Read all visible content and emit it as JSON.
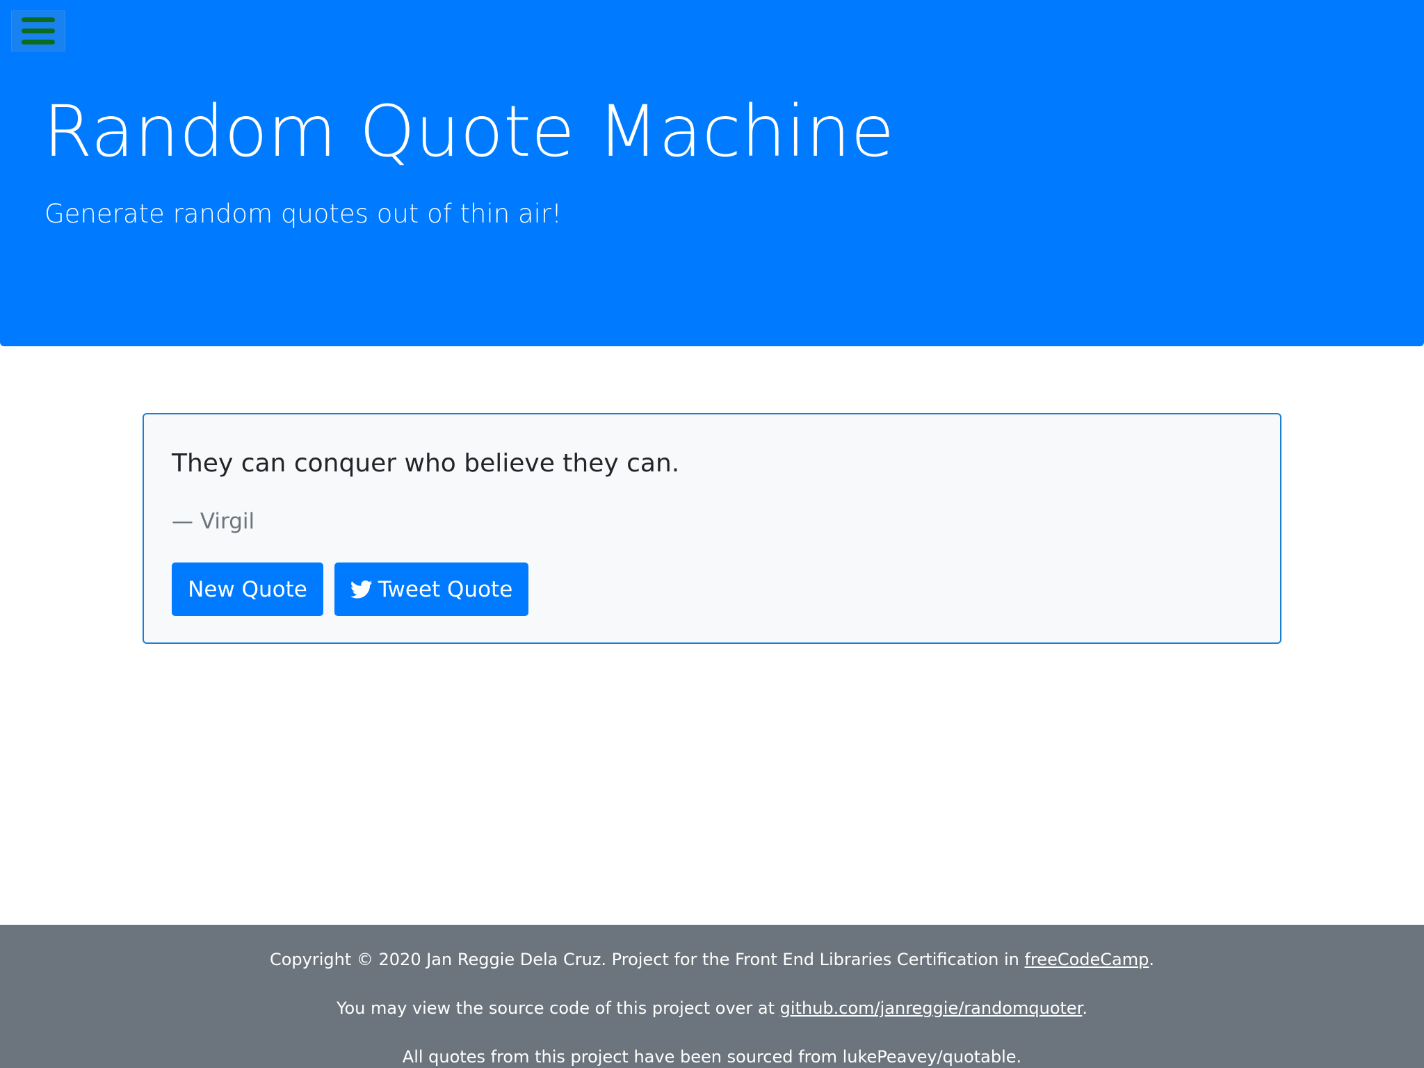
{
  "header": {
    "menu_icon": "hamburger-menu-icon",
    "title": "Random Quote Machine",
    "subtitle": "Generate random quotes out of thin air!"
  },
  "quote": {
    "text": "They can conquer who believe they can.",
    "author": "— Virgil",
    "new_quote_label": "New Quote",
    "tweet_quote_label": "Tweet Quote",
    "tweet_icon": "twitter-icon"
  },
  "footer": {
    "line1_prefix": "Copyright © 2020 Jan Reggie Dela Cruz. Project for the Front End Libraries Certification in ",
    "line1_link": "freeCodeCamp",
    "line1_suffix": ".",
    "line2_prefix": "You may view the source code of this project over at ",
    "line2_link": "github.com/janreggie/randomquoter",
    "line2_suffix": ".",
    "line3": "All quotes from this project have been sourced from lukePeavey/quotable."
  },
  "colors": {
    "primary": "#007bff",
    "card_bg": "#f8f9fa",
    "footer_bg": "#6c757d",
    "menu_bar": "#0a6b1f"
  }
}
